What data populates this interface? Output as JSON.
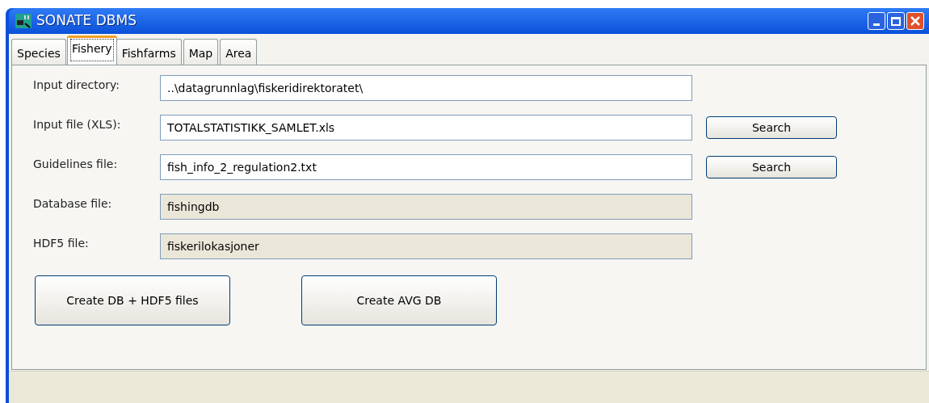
{
  "window": {
    "title": "SONATE DBMS"
  },
  "tabs": [
    {
      "label": "Species",
      "selected": false
    },
    {
      "label": "Fishery",
      "selected": true
    },
    {
      "label": "Fishfarms",
      "selected": false
    },
    {
      "label": "Map",
      "selected": false
    },
    {
      "label": "Area",
      "selected": false
    }
  ],
  "fields": [
    {
      "label": "Input directory:",
      "value": "..\\datagrunnlag\\fiskeridirektoratet\\",
      "readonly": false
    },
    {
      "label": "Input file (XLS):",
      "value": "TOTALSTATISTIKK_SAMLET.xls",
      "readonly": false,
      "button": "Search"
    },
    {
      "label": "Guidelines file:",
      "value": "fish_info_2_regulation2.txt",
      "readonly": false,
      "button": "Search"
    },
    {
      "label": "Database file:",
      "value": "fishingdb",
      "readonly": true
    },
    {
      "label": "HDF5 file:",
      "value": "fiskerilokasjoner",
      "readonly": true
    }
  ],
  "buttons": [
    "Create DB + HDF5 files",
    "Create AVG DB"
  ]
}
